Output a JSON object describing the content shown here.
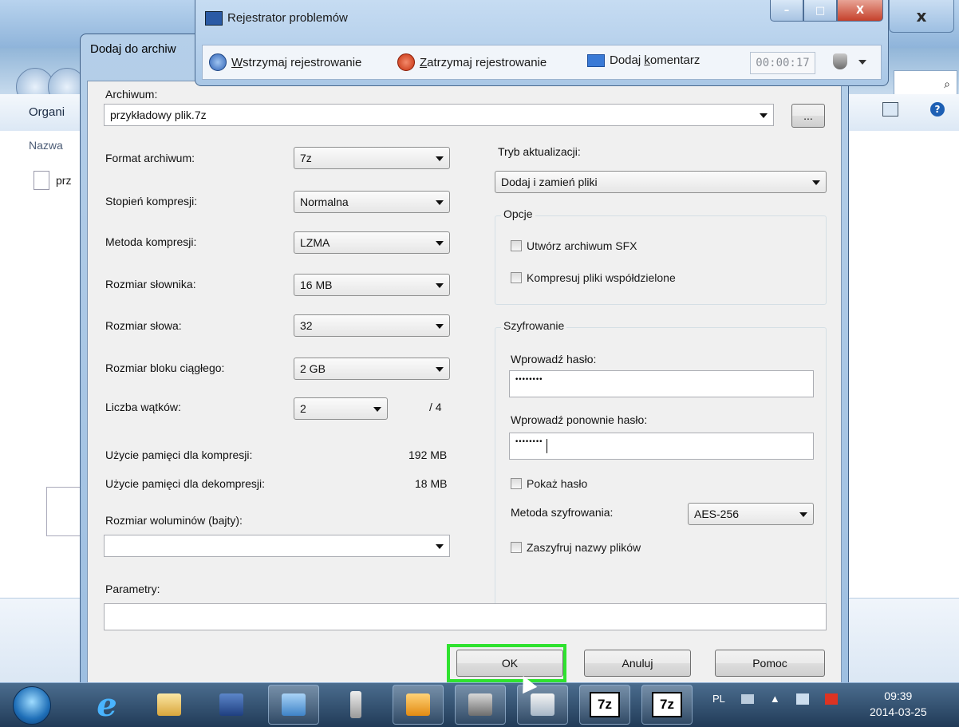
{
  "explorer": {
    "toolbar_label": "Organi",
    "column_header": "Nazwa",
    "file_label": "prz"
  },
  "recorder": {
    "title": "Rejestrator problemów",
    "pause_prefix": "",
    "pause_hot": "W",
    "pause_rest": "strzymaj rejestrowanie",
    "stop_hot": "Z",
    "stop_rest": "atrzymaj rejestrowanie",
    "comment_pre": "Dodaj ",
    "comment_hot": "k",
    "comment_rest": "omentarz",
    "timer": "00:00:17"
  },
  "dialog": {
    "title": "Dodaj do archiw",
    "archive_label": "Archiwum:",
    "archive_value": "przykładowy plik.7z",
    "browse_label": "...",
    "left": {
      "format_label": "Format archiwum:",
      "format_value": "7z",
      "level_label": "Stopień kompresji:",
      "level_value": "Normalna",
      "method_label": "Metoda kompresji:",
      "method_value": "LZMA",
      "dict_label": "Rozmiar słownika:",
      "dict_value": "16 MB",
      "word_label": "Rozmiar słowa:",
      "word_value": "32",
      "block_label": "Rozmiar bloku ciągłego:",
      "block_value": "2 GB",
      "threads_label": "Liczba wątków:",
      "threads_value": "2",
      "threads_max": "/ 4",
      "mem_comp_label": "Użycie pamięci dla kompresji:",
      "mem_comp_value": "192 MB",
      "mem_decomp_label": "Użycie pamięci dla dekompresji:",
      "mem_decomp_value": "18 MB",
      "volume_label": "Rozmiar woluminów (bajty):",
      "volume_value": ""
    },
    "right": {
      "update_label": "Tryb aktualizacji:",
      "update_value": "Dodaj i zamień pliki",
      "options_title": "Opcje",
      "sfx_label": "Utwórz archiwum SFX",
      "shared_label": "Kompresuj pliki współdzielone",
      "enc_title": "Szyfrowanie",
      "pass_label": "Wprowadź hasło:",
      "pass_value": "••••••••",
      "pass2_label": "Wprowadź ponownie hasło:",
      "pass2_value": "••••••••",
      "show_pass_label": "Pokaż hasło",
      "enc_method_label": "Metoda szyfrowania:",
      "enc_method_value": "AES-256",
      "enc_names_label": "Zaszyfruj nazwy plików"
    },
    "params_label": "Parametry:",
    "params_value": "",
    "ok_label": "OK",
    "cancel_label": "Anuluj",
    "help_label": "Pomoc"
  },
  "taskbar": {
    "lang": "PL",
    "time": "09:39",
    "date": "2014-03-25",
    "sevenzip_label": "7z"
  }
}
